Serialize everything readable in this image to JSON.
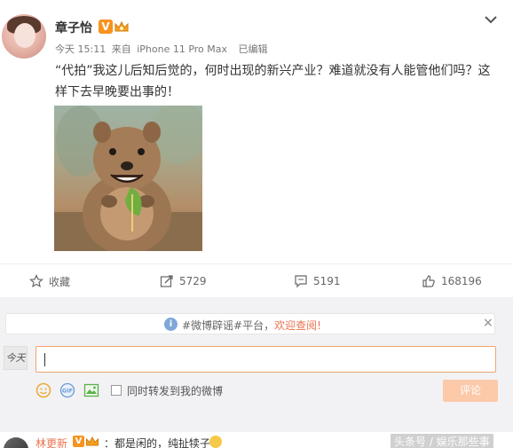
{
  "post": {
    "username": "章子怡",
    "verified_label": "V",
    "time": "今天 15:11",
    "source_prefix": "来自",
    "source_device": "iPhone 11 Pro Max",
    "edited": "已编辑",
    "text": "“代拍”我这儿后知后觉的，何时出现的新兴产业？难道就没有人能管他们吗？这样下去早晚要出事的！",
    "image_alt": "quokka holding a leaf"
  },
  "actions": {
    "favorite_label": "收藏",
    "repost_count": "5729",
    "comment_count": "5191",
    "like_count": "168196"
  },
  "notice": {
    "info_glyph": "i",
    "prefix": "#微博辟谣#平台，",
    "highlight": "欢迎查阅!",
    "close_glyph": "×"
  },
  "composer": {
    "my_avatar_text": "今天",
    "forward_label": "同时转发到我的微博",
    "submit_label": "评论"
  },
  "comment": {
    "user": "林更新",
    "verified_label": "V",
    "text": "：都是闲的，纯扯犊子",
    "watermark": "头条号 / 娱乐那些事"
  },
  "colors": {
    "accent": "#eb7350",
    "verified": "#f7931e",
    "submit_disabled": "#fcc9a9"
  },
  "icons": {
    "expand": "chevron-down-icon",
    "favorite": "star-icon",
    "repost": "edit-share-icon",
    "comment": "comment-bubble-icon",
    "like": "thumbs-up-icon",
    "emoji": "smiley-icon",
    "gif": "gif-icon",
    "image": "picture-icon"
  }
}
